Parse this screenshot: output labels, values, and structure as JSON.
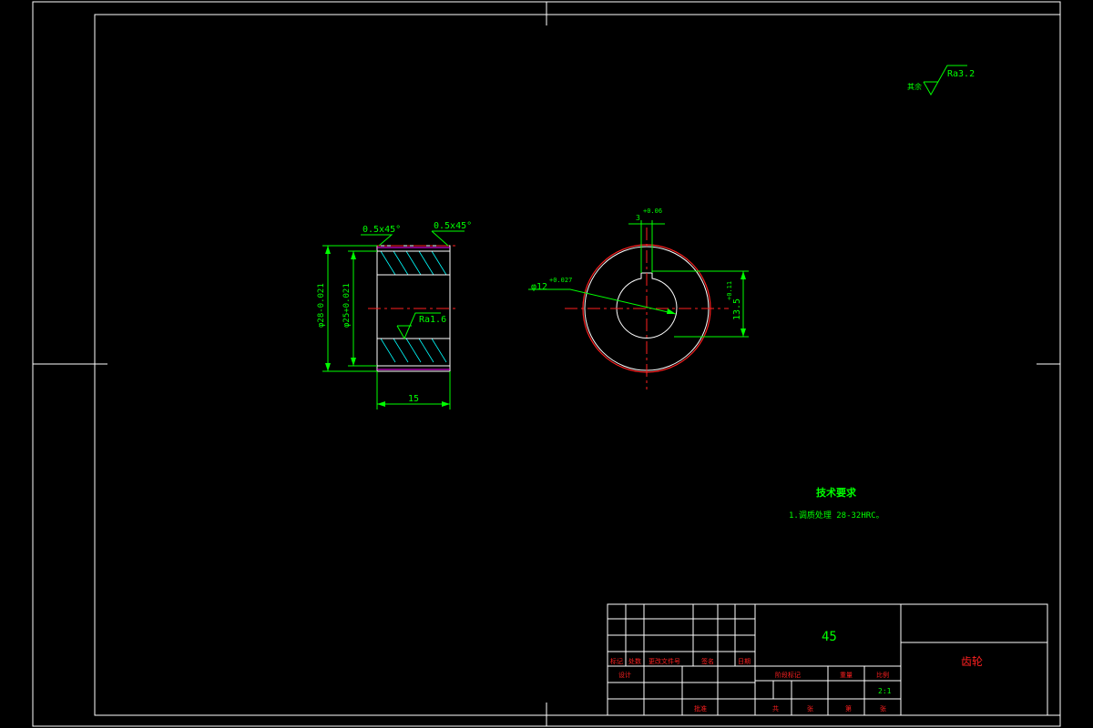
{
  "colors": {
    "background": "#000000",
    "frame": "#ffffff",
    "dimension": "#00ff00",
    "centerline": "#ff2020",
    "hatch": "#00ffff",
    "hidden": "#ff00ff"
  },
  "side_view": {
    "chamfer_left": "0.5x45°",
    "chamfer_right": "0.5x45°",
    "outer_diameter": "φ28-0.021",
    "bore_diameter": "φ25+0.021",
    "roughness": "Ra1.6",
    "width": "15"
  },
  "front_view": {
    "keyway_width": "3",
    "keyway_tol": "+0.06",
    "bore_diameter": "φ12",
    "bore_tol": "+0.027",
    "key_depth": "13.5",
    "key_depth_tol": "+0.11"
  },
  "surface_note": {
    "prefix": "其余",
    "value": "Ra3.2"
  },
  "tech_requirements": {
    "title": "技术要求",
    "item": "1.调质处理 28-32HRC。"
  },
  "title_block": {
    "material": "45",
    "part_name": "齿轮",
    "row_labels": [
      "标记",
      "处数",
      "更改文件号",
      "签名",
      "日期"
    ],
    "designer_label": "设计",
    "stage_label": "阶段标记",
    "weight_label": "重量",
    "scale_label": "比例",
    "scale": "2:1",
    "approve_label": "批准",
    "sheet_labels": [
      "共",
      "张",
      "第",
      "张"
    ]
  }
}
